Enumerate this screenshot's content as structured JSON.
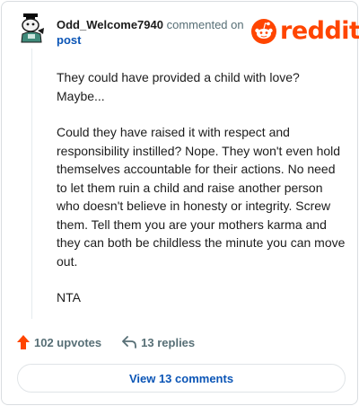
{
  "comment": {
    "username": "Odd_Welcome7940",
    "action_text": "commented on",
    "target_link": "post",
    "paragraphs": [
      "They could have provided a child with love? Maybe...",
      "Could they have raised it with respect and responsibility instilled? Nope. They won't even hold themselves accountable for their actions. No need to let them ruin a child and raise another person who doesn't believe in honesty or integrity. Screw them. Tell them you are your mothers karma and they can both be childless the minute you can move out.",
      "NTA"
    ]
  },
  "brand": {
    "wordmark": "reddit",
    "color": "#ff4500"
  },
  "actions": {
    "upvotes": "102 upvotes",
    "replies": "13 replies"
  },
  "footer": {
    "view_comments": "View 13 comments"
  },
  "icons": {
    "avatar": "snoo-avatar-icon",
    "logo": "reddit-logo-icon",
    "upvote": "upvote-arrow-icon",
    "reply": "reply-arrow-icon"
  }
}
